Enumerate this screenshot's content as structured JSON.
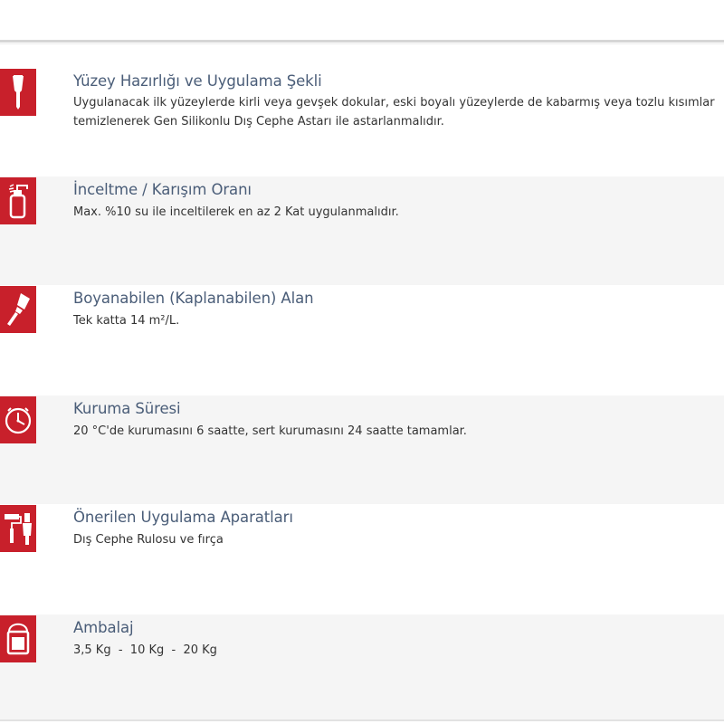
{
  "sections": [
    {
      "icon": "scraper-icon",
      "title": "Yüzey Hazırlığı ve Uygulama Şekli",
      "text": "Uygulanacak ilk yüzeylerde kirli veya gevşek dokular, eski boyalı yüzeylerde de kabarmış veya tozlu kısımlar temizlenerek Gen Silikonlu Dış Cephe Astarı ile astarlanmalıdır."
    },
    {
      "icon": "spray-bottle-icon",
      "title": "İnceltme / Karışım Oranı",
      "text": "Max. %10 su ile inceltilerek en az 2 Kat uygulanmalıdır."
    },
    {
      "icon": "paint-brush-icon",
      "title": "Boyanabilen (Kaplanabilen) Alan",
      "text": "Tek katta 14 m²/L."
    },
    {
      "icon": "clock-icon",
      "title": "Kuruma Süresi",
      "text": "20 °C'de kurumasını 6 saatte, sert kurumasını 24 saatte tamamlar."
    },
    {
      "icon": "roller-brush-icon",
      "title": "Önerilen Uygulama Aparatları",
      "text": "Dış Cephe Rulosu ve fırça"
    },
    {
      "icon": "paint-bucket-icon",
      "title": "Ambalaj",
      "text": "3,5 Kg  -  10 Kg  -  20 Kg"
    }
  ],
  "colors": {
    "icon_background": "#c8202b",
    "title": "#4a5d78",
    "text": "#333333",
    "shaded_row": "#f5f5f5"
  }
}
